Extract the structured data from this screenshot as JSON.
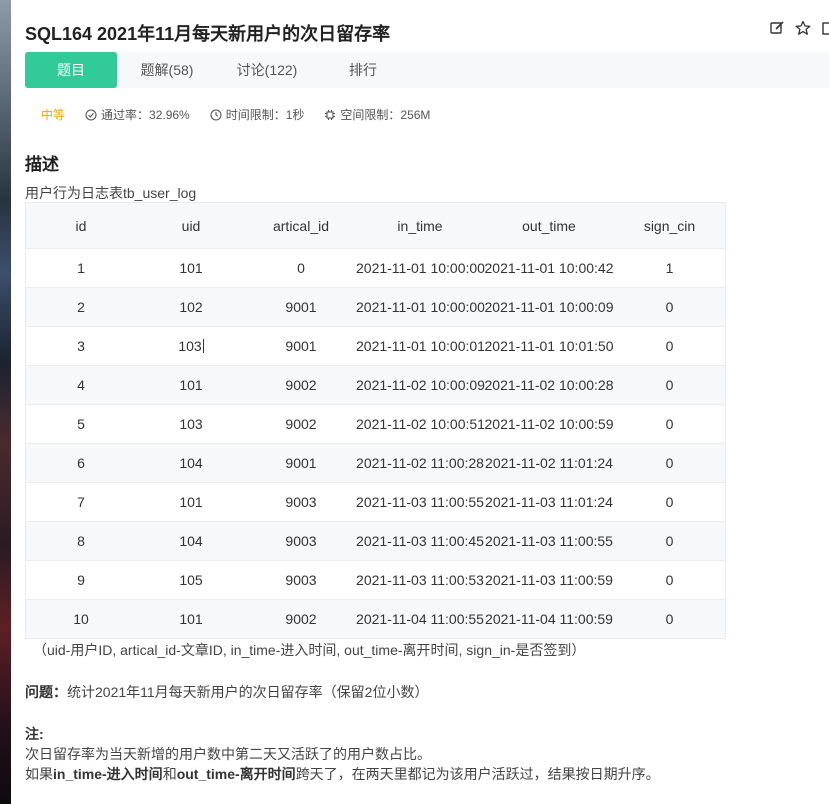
{
  "header": {
    "title": "SQL164  2021年11月每天新用户的次日留存率",
    "actions": [
      "edit-icon",
      "star-icon",
      "more-icon"
    ]
  },
  "tabs": [
    {
      "label": "题目",
      "active": true
    },
    {
      "label": "题解(58)",
      "active": false
    },
    {
      "label": "讨论(122)",
      "active": false
    },
    {
      "label": "排行",
      "active": false
    }
  ],
  "meta": {
    "level": "中等",
    "pass_rate": "通过率：32.96%",
    "time_limit": "时间限制：1秒",
    "space_limit": "空间限制：256M"
  },
  "description": {
    "heading": "描述",
    "table_caption": "用户行为日志表tb_user_log",
    "columns": [
      "id",
      "uid",
      "artical_id",
      "in_time",
      "out_time",
      "sign_cin"
    ],
    "rows": [
      [
        "1",
        "101",
        "0",
        "2021-11-01 10:00:00",
        "2021-11-01 10:00:42",
        "1"
      ],
      [
        "2",
        "102",
        "9001",
        "2021-11-01 10:00:00",
        "2021-11-01 10:00:09",
        "0"
      ],
      [
        "3",
        "103",
        "9001",
        "2021-11-01 10:00:01",
        "2021-11-01 10:01:50",
        "0"
      ],
      [
        "4",
        "101",
        "9002",
        "2021-11-02 10:00:09",
        "2021-11-02 10:00:28",
        "0"
      ],
      [
        "5",
        "103",
        "9002",
        "2021-11-02 10:00:51",
        "2021-11-02 10:00:59",
        "0"
      ],
      [
        "6",
        "104",
        "9001",
        "2021-11-02 11:00:28",
        "2021-11-02 11:01:24",
        "0"
      ],
      [
        "7",
        "101",
        "9003",
        "2021-11-03 11:00:55",
        "2021-11-03 11:01:24",
        "0"
      ],
      [
        "8",
        "104",
        "9003",
        "2021-11-03 11:00:45",
        "2021-11-03 11:00:55",
        "0"
      ],
      [
        "9",
        "105",
        "9003",
        "2021-11-03 11:00:53",
        "2021-11-03 11:00:59",
        "0"
      ],
      [
        "10",
        "101",
        "9002",
        "2021-11-04 11:00:55",
        "2021-11-04 11:00:59",
        "0"
      ]
    ],
    "column_note": "（uid-用户ID, artical_id-文章ID, in_time-进入时间, out_time-离开时间, sign_in-是否签到）"
  },
  "question": {
    "label": "问题：",
    "text": "统计2021年11月每天新用户的次日留存率（保留2位小数）"
  },
  "notes": {
    "label": "注:",
    "line1": "次日留存率为当天新增的用户数中第二天又活跃了的用户数占比。",
    "line2_prefix": "如果",
    "line2_bold1": "in_time-进入时间",
    "line2_mid": "和",
    "line2_bold2": "out_time-离开时间",
    "line2_suffix": "跨天了，在两天里都记为该用户活跃过，结果按日期升序。"
  }
}
